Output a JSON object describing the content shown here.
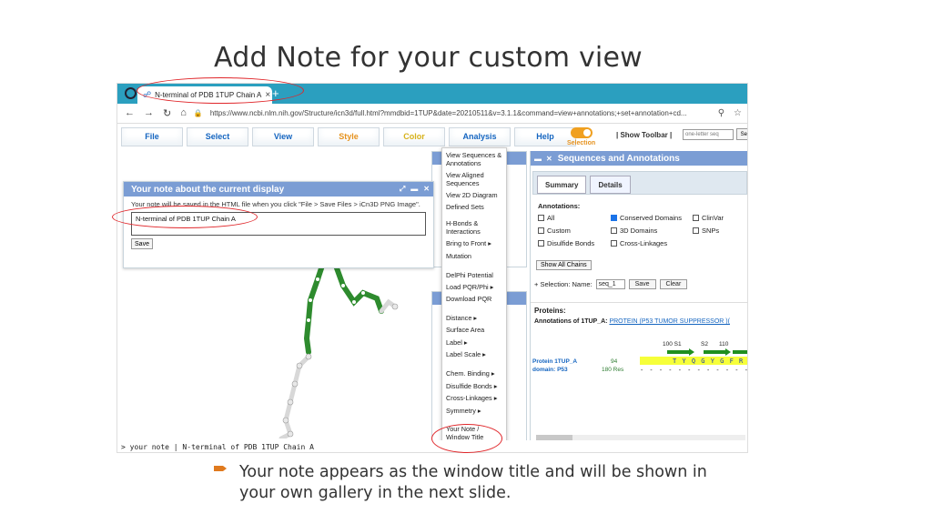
{
  "slide": {
    "title": "Add Note for your custom view",
    "bullet": "Your note appears as the window title and will be shown in your own gallery in the next slide."
  },
  "browser": {
    "tab_title": "N-terminal of PDB 1TUP Chain A",
    "tab_close": "×",
    "new_tab": "+",
    "url": "https://www.ncbi.nlm.nih.gov/Structure/icn3d/full.html?mmdbid=1TUP&date=20210511&v=3.1.1&command=view+annotations;+set+annotation+cd..."
  },
  "menu": {
    "items": [
      "File",
      "Select",
      "View",
      "Style",
      "Color",
      "Analysis",
      "Help"
    ],
    "selection_label": "Selection",
    "show_toolbar": "| Show Toolbar |",
    "seq_placeholder": "one-letter seq",
    "search_btn": "Sea"
  },
  "note_dialog": {
    "title": "Your note about the current display",
    "hint": "Your note will be saved in the HTML file when you click \"File > Save Files > iCn3D PNG Image\".",
    "value": "N-terminal of PDB 1TUP Chain A",
    "save": "Save"
  },
  "analysis_menu": [
    "View Sequences & Annotations",
    "View Aligned Sequences",
    "View 2D Diagram",
    "Defined Sets",
    "H-Bonds & Interactions",
    "Bring to Front ▸",
    "Mutation",
    "DelPhi Potential",
    "Load PQR/Phi ▸",
    "Download PQR",
    "Distance ▸",
    "Surface Area",
    "Label ▸",
    "Label Scale ▸",
    "Chem. Binding ▸",
    "Disulfide Bonds ▸",
    "Cross-Linkages ▸",
    "Symmetry ▸",
    "Your Note / Window Title"
  ],
  "seq_panel": {
    "title": "Sequences and Annotations",
    "tab_summary": "Summary",
    "tab_details": "Details",
    "annotations_label": "Annotations:",
    "checkboxes": {
      "all": "All",
      "conserved": "Conserved Domains",
      "clinvar": "ClinVar",
      "custom": "Custom",
      "d3": "3D Domains",
      "snps": "SNPs",
      "disulfide": "Disulfide Bonds",
      "crosslink": "Cross-Linkages"
    },
    "show_all_chains": "Show All Chains",
    "selection_prefix": "+  Selection: Name:",
    "selection_value": "seq_1",
    "save": "Save",
    "clear": "Clear",
    "proteins": "Proteins:",
    "annot_of": "Annotations of 1TUP_A:",
    "annot_link": "PROTEIN (P53 TUMOR SUPPRESSOR )(",
    "tick_100": "100 S1",
    "tick_s2": "S2",
    "tick_110": "110",
    "protein_label": "Protein 1TUP_A",
    "domain_label": "domain: P53",
    "res_num": "94",
    "res_count": "180 Res",
    "seq1": "T Y Q G  Y G F R L G F",
    "seq2": "- - - - - - - - - - - - - - F R L G F L"
  },
  "command_line": "> your note | N-terminal of PDB 1TUP Chain A"
}
